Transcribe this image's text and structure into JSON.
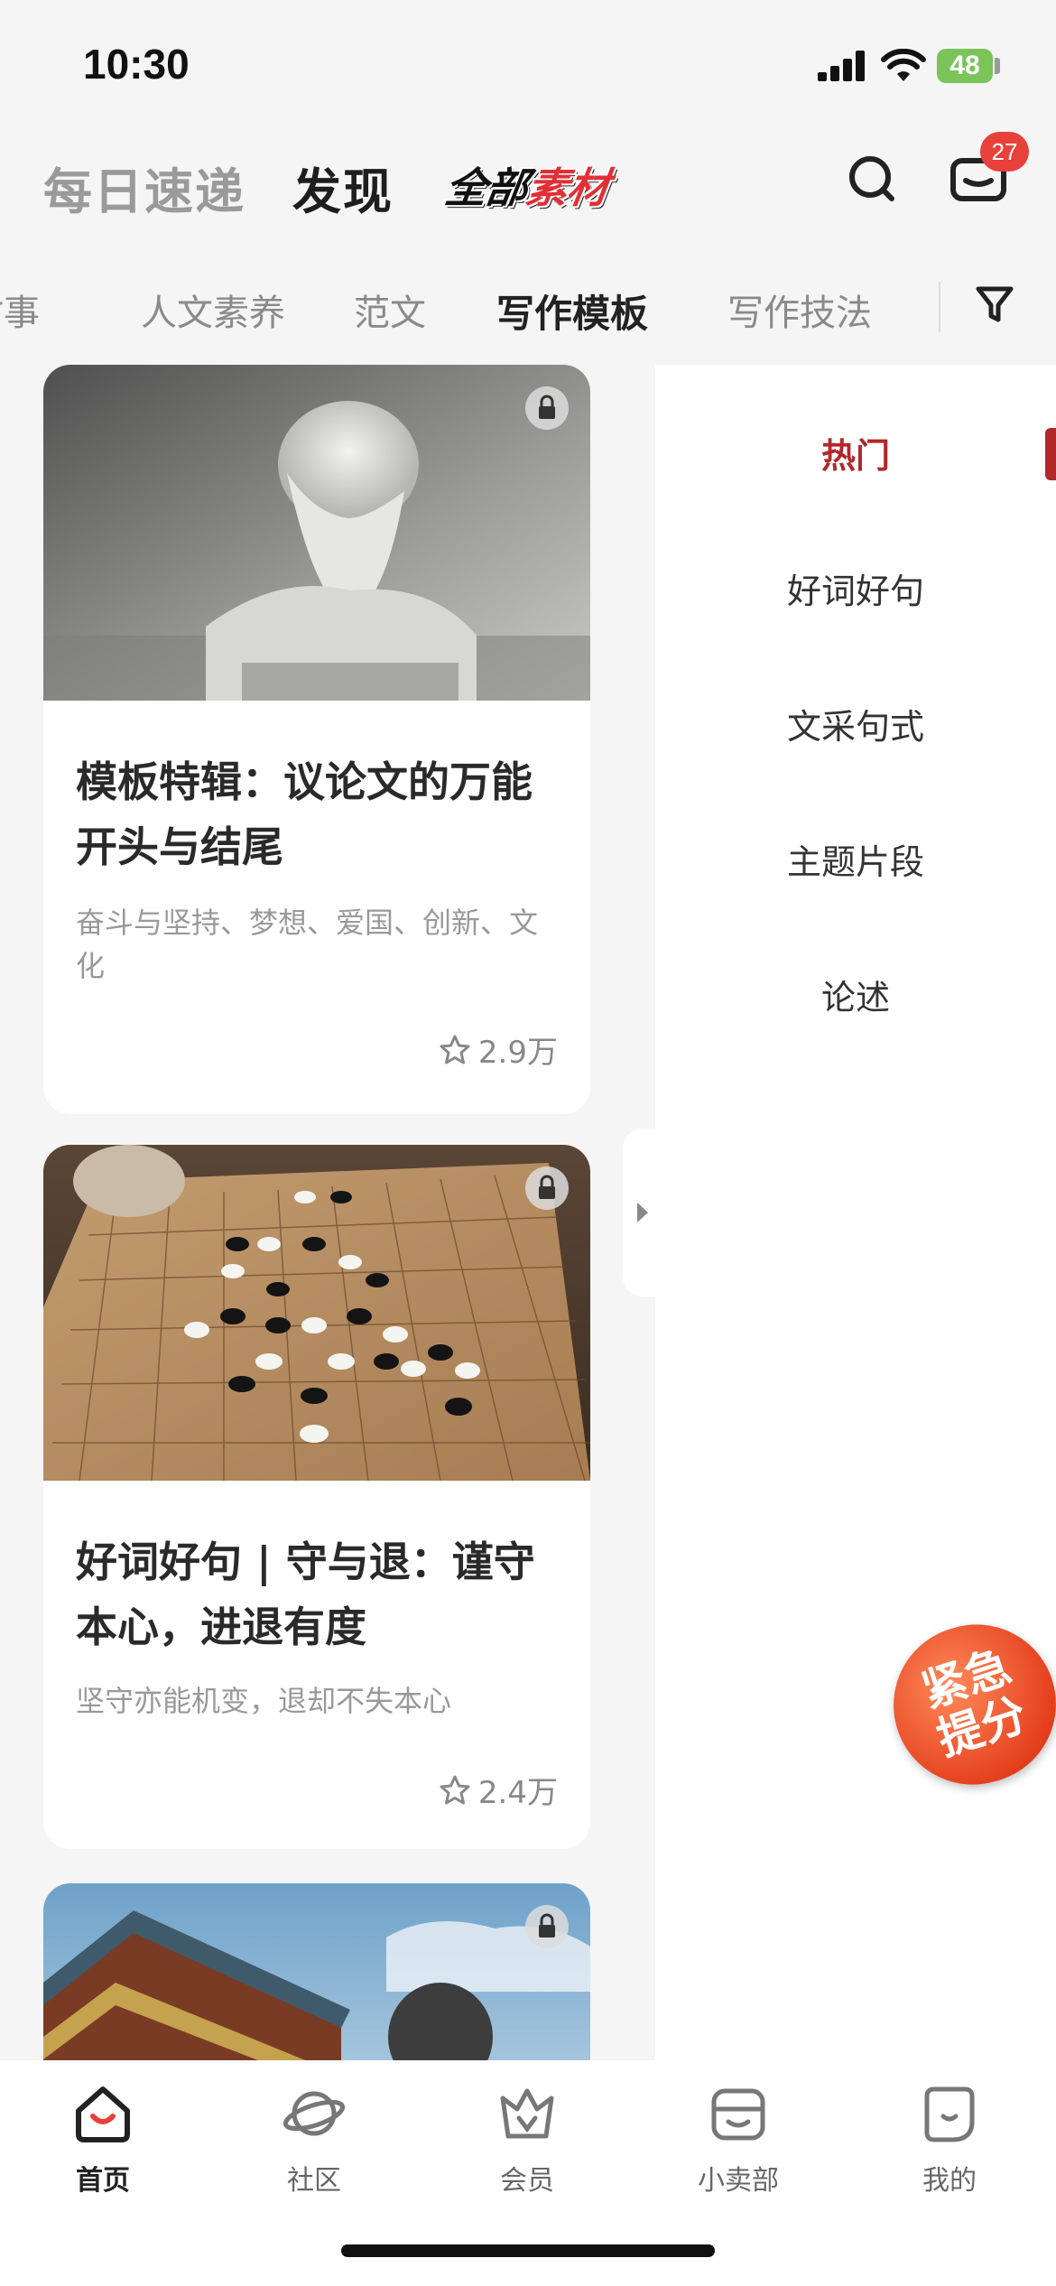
{
  "status_bar": {
    "time": "10:30",
    "battery": "48"
  },
  "header": {
    "tabs": [
      {
        "label": "每日速递"
      },
      {
        "label": "发现"
      }
    ],
    "logo_text_a": "全部",
    "logo_text_b": "素材",
    "mail_badge": "27"
  },
  "categories": {
    "items": [
      {
        "label": "时事"
      },
      {
        "label": "人文素养"
      },
      {
        "label": "范文"
      },
      {
        "label": "写作模板"
      },
      {
        "label": "写作技法"
      }
    ],
    "active": "写作模板"
  },
  "side_menu": {
    "items": [
      {
        "label": "热门"
      },
      {
        "label": "好词好句"
      },
      {
        "label": "文采句式"
      },
      {
        "label": "主题片段"
      },
      {
        "label": "论述"
      }
    ],
    "active": "热门"
  },
  "cards": [
    {
      "title": "模板特辑：议论文的万能开头与结尾",
      "desc": "奋斗与坚持、梦想、爱国、创新、文化",
      "likes": "2.9万"
    },
    {
      "title": "好词好句 | 守与退：谨守本心，进退有度",
      "desc": "坚守亦能机变，退却不失本心",
      "likes": "2.4万"
    },
    {
      "title": "",
      "desc": "",
      "likes": ""
    }
  ],
  "floating_button": {
    "line1": "紧急",
    "line2": "提分"
  },
  "bottom_nav": {
    "items": [
      {
        "label": "首页"
      },
      {
        "label": "社区"
      },
      {
        "label": "会员"
      },
      {
        "label": "小卖部"
      },
      {
        "label": "我的"
      }
    ]
  },
  "colors": {
    "accent": "#b2282a",
    "badge": "#e8403a",
    "battery": "#7ac45a"
  },
  "icons": [
    "search-icon",
    "mail-icon",
    "filter-icon",
    "lock-icon",
    "star-icon",
    "chevron-right-icon",
    "home-icon",
    "planet-icon",
    "crown-icon",
    "shop-icon",
    "profile-icon"
  ]
}
